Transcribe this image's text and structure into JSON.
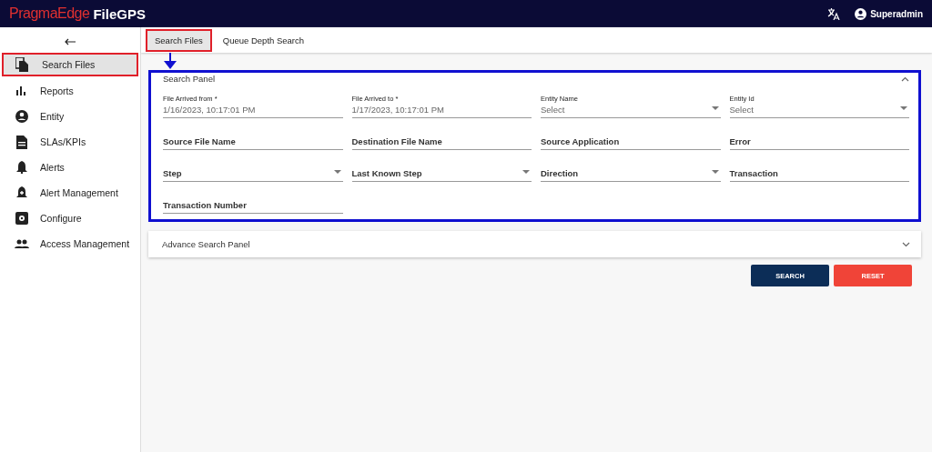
{
  "header": {
    "logo_brand": "PragmaEdge",
    "logo_product": "FileGPS",
    "user": "Superadmin"
  },
  "sidebar": {
    "items": [
      {
        "label": "Search Files",
        "kind": "files",
        "selected": true
      },
      {
        "label": "Reports",
        "kind": "bars",
        "selected": false
      },
      {
        "label": "Entity",
        "kind": "person",
        "selected": false
      },
      {
        "label": "SLAs/KPIs",
        "kind": "doc",
        "selected": false
      },
      {
        "label": "Alerts",
        "kind": "bell",
        "selected": false
      },
      {
        "label": "Alert Management",
        "kind": "bellplus",
        "selected": false
      },
      {
        "label": "Configure",
        "kind": "gear",
        "selected": false
      },
      {
        "label": "Access Management",
        "kind": "people",
        "selected": false
      }
    ]
  },
  "tabs": [
    {
      "label": "Search Files",
      "selected": true
    },
    {
      "label": "Queue Depth Search",
      "selected": false
    }
  ],
  "search_panel": {
    "title": "Search Panel",
    "expanded": true,
    "fields": [
      {
        "kind": "text",
        "label": "File Arrived from *",
        "value": "1/16/2023, 10:17:01 PM"
      },
      {
        "kind": "text",
        "label": "File Arrived to *",
        "value": "1/17/2023, 10:17:01 PM"
      },
      {
        "kind": "select",
        "label": "Entity Name",
        "value": "Select"
      },
      {
        "kind": "select",
        "label": "Entity Id",
        "value": "Select"
      },
      {
        "kind": "text",
        "label": "Source File Name"
      },
      {
        "kind": "text",
        "label": "Destination File Name"
      },
      {
        "kind": "text",
        "label": "Source Application"
      },
      {
        "kind": "text",
        "label": "Error"
      },
      {
        "kind": "select",
        "label": "Step"
      },
      {
        "kind": "select",
        "label": "Last Known Step"
      },
      {
        "kind": "select",
        "label": "Direction"
      },
      {
        "kind": "text",
        "label": "Transaction"
      },
      {
        "kind": "text",
        "label": "Transaction Number"
      }
    ]
  },
  "advance_panel": {
    "title": "Advance Search Panel",
    "expanded": false
  },
  "buttons": [
    {
      "label": "SEARCH",
      "kind": "primary"
    },
    {
      "label": "RESET",
      "kind": "danger"
    }
  ]
}
